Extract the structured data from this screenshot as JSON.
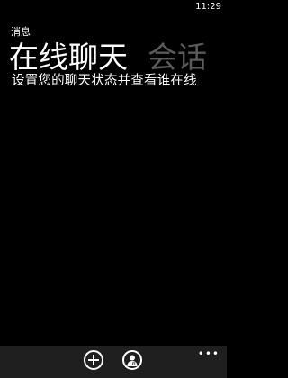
{
  "status_bar": {
    "time": "11:29"
  },
  "app": {
    "title": "消息"
  },
  "pivot": {
    "items": [
      {
        "label": "在线聊天",
        "active": true
      },
      {
        "label": "会话",
        "active": false
      }
    ]
  },
  "content": {
    "message": "设置您的聊天状态并查看谁在线"
  },
  "app_bar": {
    "buttons": [
      {
        "icon": "add-icon"
      },
      {
        "icon": "person-status-icon"
      }
    ],
    "more_icon": "ellipsis-icon"
  },
  "colors": {
    "background": "#000000",
    "text": "#ffffff",
    "inactive_pivot": "#5a5a5a",
    "app_bar": "#1f1f1f"
  }
}
